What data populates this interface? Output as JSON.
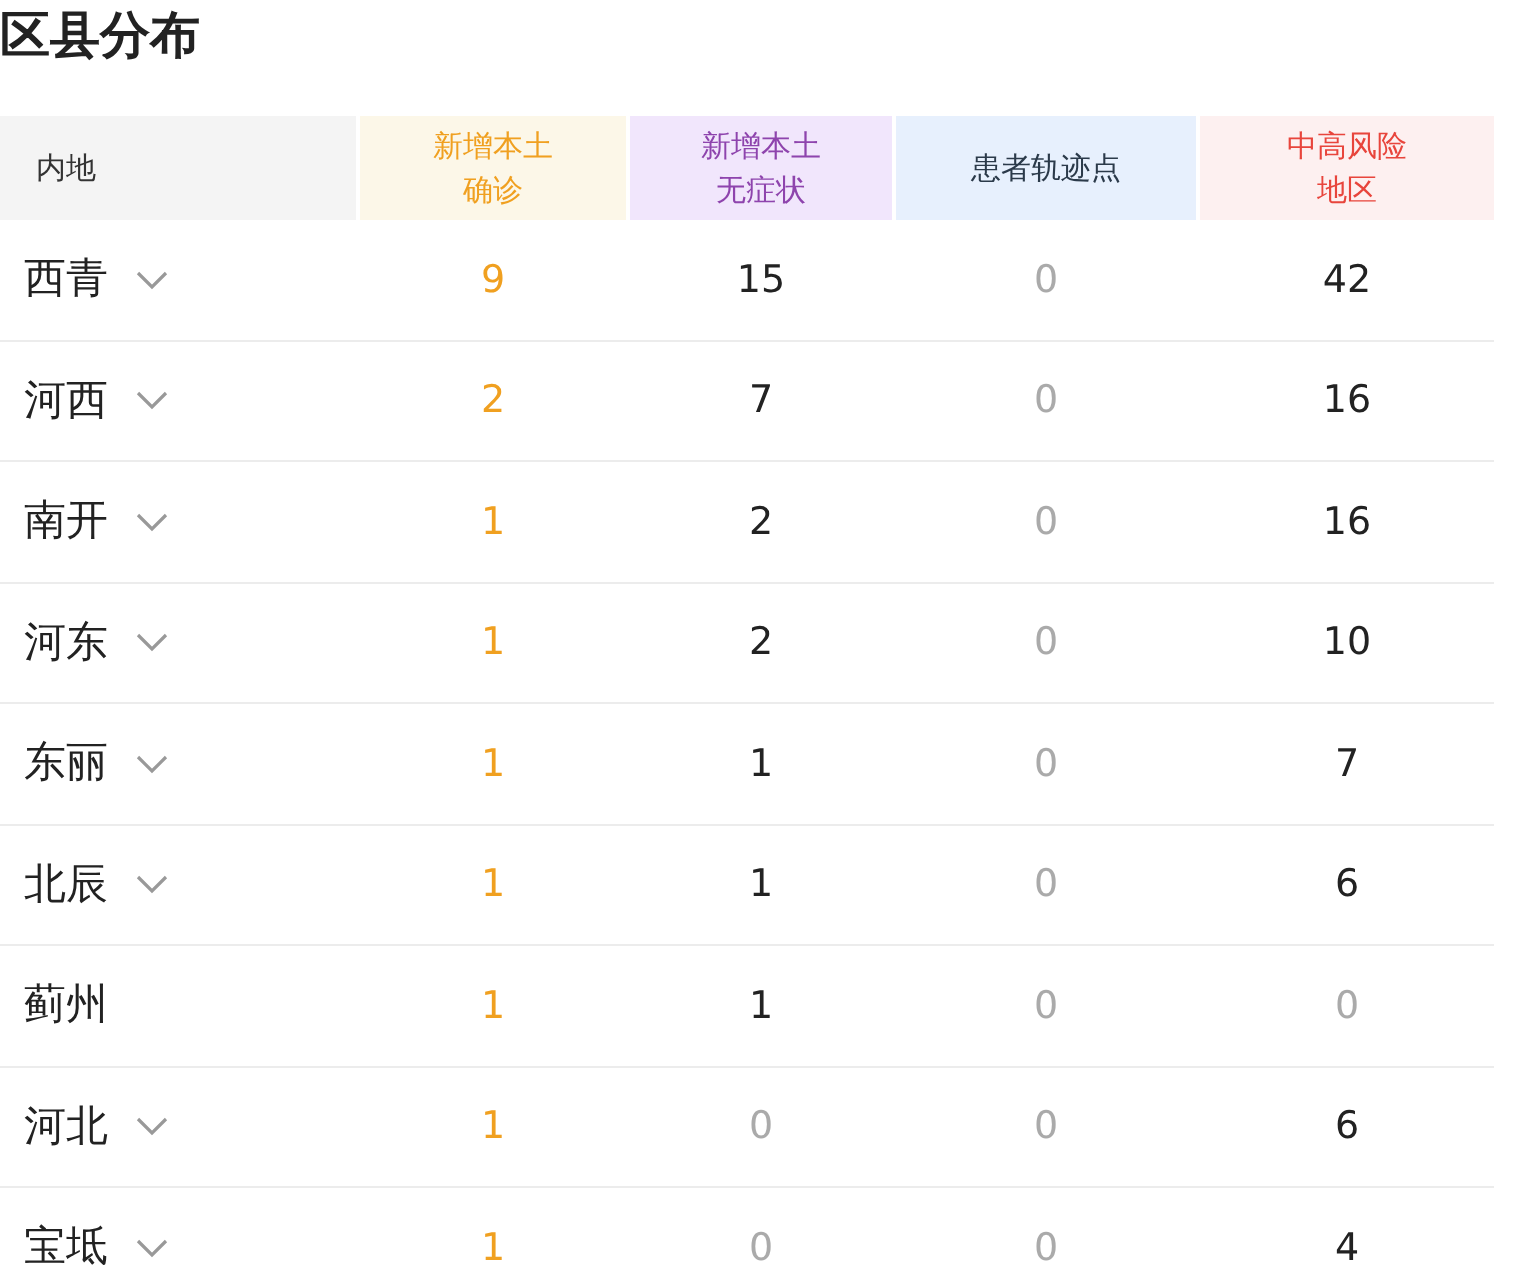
{
  "title": "区县分布",
  "columns": [
    {
      "lines": [
        "内地"
      ],
      "color": "#333333"
    },
    {
      "lines": [
        "新增本土",
        "确诊"
      ],
      "color": "#f0a020"
    },
    {
      "lines": [
        "新增本土",
        "无症状"
      ],
      "color": "#8e44ad"
    },
    {
      "lines": [
        "患者轨迹点"
      ],
      "color": "#2b3a4a"
    },
    {
      "lines": [
        "中高风险",
        "地区"
      ],
      "color": "#e8453c"
    }
  ],
  "rows": [
    {
      "name": "西青",
      "expandable": true,
      "cells": [
        {
          "value": "9",
          "muted": false
        },
        {
          "value": "15",
          "muted": false
        },
        {
          "value": "0",
          "muted": true
        },
        {
          "value": "42",
          "muted": false
        }
      ]
    },
    {
      "name": "河西",
      "expandable": true,
      "cells": [
        {
          "value": "2",
          "muted": false
        },
        {
          "value": "7",
          "muted": false
        },
        {
          "value": "0",
          "muted": true
        },
        {
          "value": "16",
          "muted": false
        }
      ]
    },
    {
      "name": "南开",
      "expandable": true,
      "cells": [
        {
          "value": "1",
          "muted": false
        },
        {
          "value": "2",
          "muted": false
        },
        {
          "value": "0",
          "muted": true
        },
        {
          "value": "16",
          "muted": false
        }
      ]
    },
    {
      "name": "河东",
      "expandable": true,
      "cells": [
        {
          "value": "1",
          "muted": false
        },
        {
          "value": "2",
          "muted": false
        },
        {
          "value": "0",
          "muted": true
        },
        {
          "value": "10",
          "muted": false
        }
      ]
    },
    {
      "name": "东丽",
      "expandable": true,
      "cells": [
        {
          "value": "1",
          "muted": false
        },
        {
          "value": "1",
          "muted": false
        },
        {
          "value": "0",
          "muted": true
        },
        {
          "value": "7",
          "muted": false
        }
      ]
    },
    {
      "name": "北辰",
      "expandable": true,
      "cells": [
        {
          "value": "1",
          "muted": false
        },
        {
          "value": "1",
          "muted": false
        },
        {
          "value": "0",
          "muted": true
        },
        {
          "value": "6",
          "muted": false
        }
      ]
    },
    {
      "name": "蓟州",
      "expandable": false,
      "cells": [
        {
          "value": "1",
          "muted": false
        },
        {
          "value": "1",
          "muted": false
        },
        {
          "value": "0",
          "muted": true
        },
        {
          "value": "0",
          "muted": true
        }
      ]
    },
    {
      "name": "河北",
      "expandable": true,
      "cells": [
        {
          "value": "1",
          "muted": false
        },
        {
          "value": "0",
          "muted": true
        },
        {
          "value": "0",
          "muted": true
        },
        {
          "value": "6",
          "muted": false
        }
      ]
    },
    {
      "name": "宝坻",
      "expandable": true,
      "cells": [
        {
          "value": "1",
          "muted": false
        },
        {
          "value": "0",
          "muted": true
        },
        {
          "value": "0",
          "muted": true
        },
        {
          "value": "4",
          "muted": false
        }
      ]
    }
  ]
}
